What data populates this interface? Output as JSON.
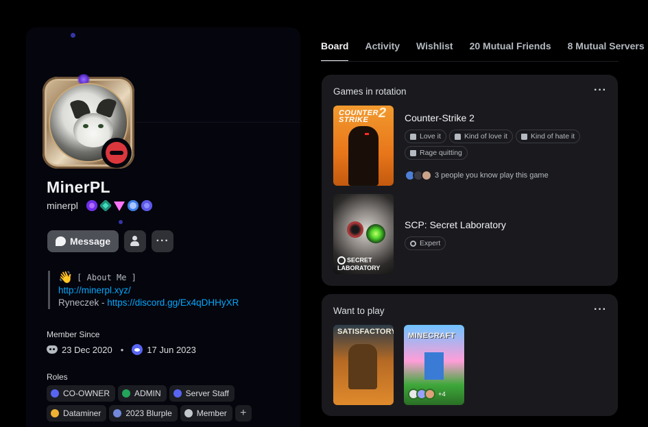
{
  "profile": {
    "display_name": "MinerPL",
    "username": "minerpl",
    "badges": [
      "nitro-badge-icon",
      "hypesquad-badge-icon",
      "gem-badge-icon",
      "boost-badge-icon",
      "quest-badge-icon"
    ],
    "status": "do-not-disturb",
    "actions": {
      "message_label": "Message",
      "more_label": "···"
    },
    "about": {
      "line1": "[ About Me ]",
      "link": "http://minerpl.xyz/",
      "line3_prefix": "Ryneczek - ",
      "line3_link": "https://discord.gg/Ex4qDHHyXR"
    },
    "member_since": {
      "label": "Member Since",
      "discord_date": "23 Dec 2020",
      "separator": "•",
      "server_date": "17 Jun 2023"
    },
    "roles": {
      "label": "Roles",
      "items": [
        {
          "name": "CO-OWNER",
          "color": "#5865f2"
        },
        {
          "name": "ADMIN",
          "color": "#23a55a"
        },
        {
          "name": "Server Staff",
          "color": "#5865f2"
        },
        {
          "name": "Dataminer",
          "color": "#f0b232"
        },
        {
          "name": "2023 Blurple",
          "color": "#7289da"
        },
        {
          "name": "Member",
          "color": "#c4c9ce"
        }
      ],
      "add_label": "+"
    }
  },
  "tabs": [
    {
      "label": "Board",
      "active": true
    },
    {
      "label": "Activity",
      "active": false
    },
    {
      "label": "Wishlist",
      "active": false
    },
    {
      "label": "20 Mutual Friends",
      "active": false
    },
    {
      "label": "8 Mutual Servers",
      "active": false
    }
  ],
  "games_in_rotation": {
    "title": "Games in rotation",
    "more_label": "···",
    "games": [
      {
        "name": "Counter-Strike 2",
        "cover_text": "COUNTER STRIKE",
        "cover_number": "2",
        "tags": [
          "Love it",
          "Kind of love it",
          "Kind of hate it",
          "Rage quitting"
        ],
        "friends_text": "3 people you know play this game"
      },
      {
        "name": "SCP: Secret Laboratory",
        "cover_text": "SECRET LABORATORY",
        "tags": [
          "Expert"
        ]
      }
    ]
  },
  "want_to_play": {
    "title": "Want to play",
    "more_label": "···",
    "games": [
      {
        "cover_text": "SATISFACTORY"
      },
      {
        "cover_text": "MINECRAFT",
        "friends_more": "+4"
      }
    ]
  },
  "colors": {
    "background": "#000000",
    "panel": "#05050d",
    "card": "#1a1a1e",
    "link": "#00a8fc",
    "dnd": "#da373c"
  }
}
